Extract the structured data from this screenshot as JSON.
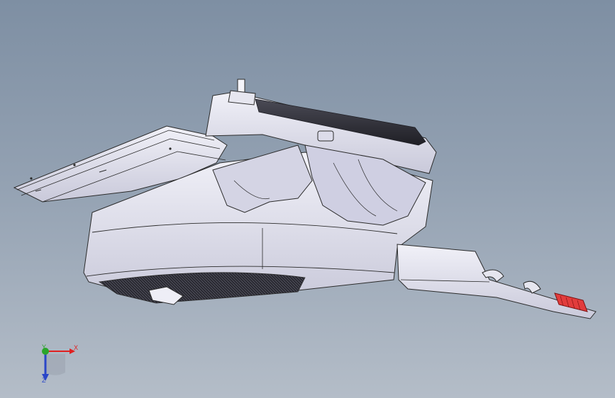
{
  "viewport": {
    "background_top": "#7e8fa3",
    "background_bottom": "#b4bdc8",
    "model_fill": "#e3e3ef",
    "model_shadow": "#b6b6c8",
    "model_edge": "#2b2b2b",
    "handle_color": "#e23c3c"
  },
  "triad": {
    "x_label": "X",
    "y_label": "Y",
    "z_label": "Z",
    "x_color": "#e02020",
    "y_color": "#2aa52a",
    "z_color": "#2a46c8"
  }
}
